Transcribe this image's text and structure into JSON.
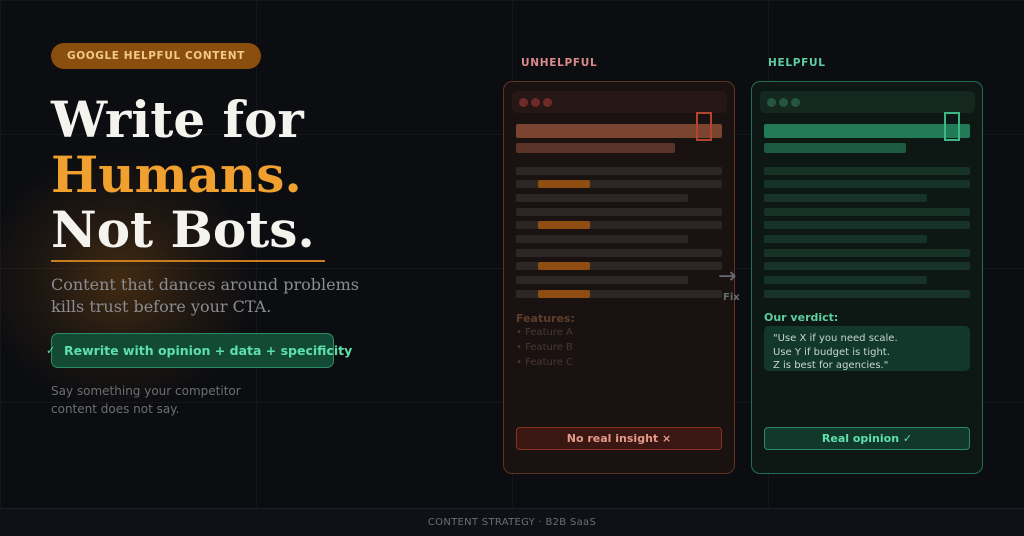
{
  "badge": "GOOGLE HELPFUL CONTENT",
  "headline": {
    "line1": "Write for",
    "line2": "Humans.",
    "line3": "Not Bots."
  },
  "subheadline": {
    "line1": "Content that dances around problems",
    "line2": "kills trust before your CTA."
  },
  "cta": {
    "check": "✓",
    "label": "Rewrite with opinion + data + specificity"
  },
  "note": {
    "line1": "Say something your competitor",
    "line2": "content does not say."
  },
  "unhelpful": {
    "label": "UNHELPFUL",
    "features_title": "Features:",
    "features": [
      "• Feature A",
      "• Feature B",
      "• Feature C"
    ],
    "footer_label": "No real insight  ×"
  },
  "helpful": {
    "label": "HELPFUL",
    "verdict_title": "Our verdict:",
    "verdict_text": "\"Use X if you need scale.\nUse Y if budget is tight.\nZ is best for agencies.\"",
    "footer_label": "Real opinion  ✓"
  },
  "transition": {
    "arrow": "→",
    "label": "Fix"
  },
  "footer": "CONTENT STRATEGY  ·  B2B SaaS",
  "colors": {
    "background": "#0c0d11",
    "accent_orange": "#f0a02e",
    "accent_green": "#5ee0ad",
    "unhelpful_red": "#b3442c"
  }
}
